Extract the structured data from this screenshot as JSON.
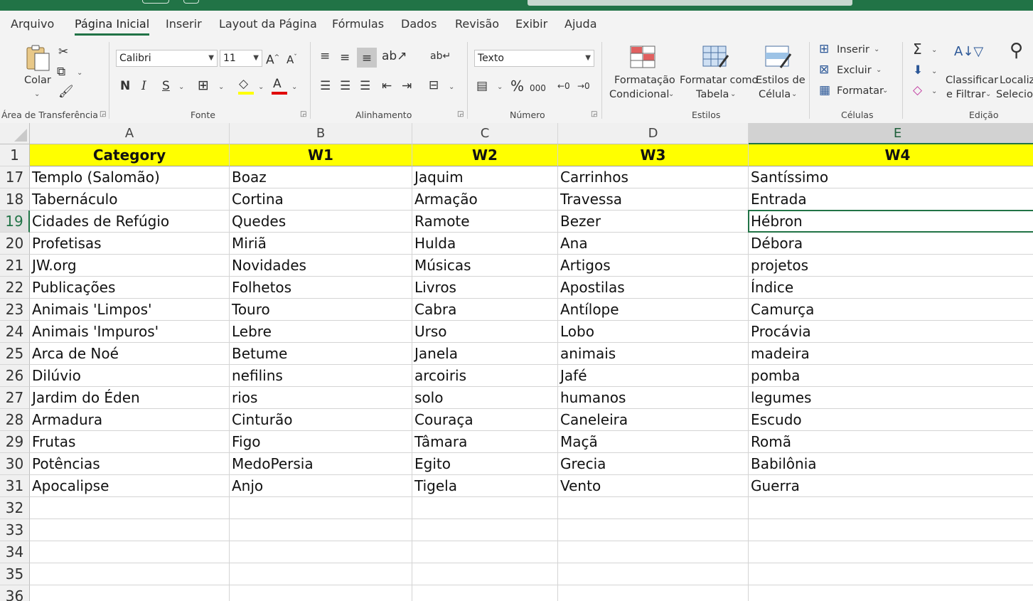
{
  "menu": {
    "tabs": [
      "Arquivo",
      "Página Inicial",
      "Inserir",
      "Layout da Página",
      "Fórmulas",
      "Dados",
      "Revisão",
      "Exibir",
      "Ajuda"
    ],
    "active": "Página Inicial"
  },
  "ribbon": {
    "clipboard": {
      "paste_label": "Colar",
      "group_label": "Área de Transferência"
    },
    "font": {
      "font_name": "Calibri",
      "font_size": "11",
      "bold": "N",
      "italic": "I",
      "underline": "S",
      "group_label": "Fonte"
    },
    "alignment": {
      "group_label": "Alinhamento"
    },
    "number": {
      "format": "Texto",
      "percent": "%",
      "thousands": "000",
      "group_label": "Número"
    },
    "styles": {
      "cond_format_line1": "Formatação",
      "cond_format_line2": "Condicional",
      "format_table_line1": "Formatar como",
      "format_table_line2": "Tabela",
      "cell_styles_line1": "Estilos de",
      "cell_styles_line2": "Célula",
      "group_label": "Estilos"
    },
    "cells": {
      "insert": "Inserir",
      "delete": "Excluir",
      "format": "Formatar",
      "group_label": "Células"
    },
    "editing": {
      "sort_line1": "Classificar",
      "sort_line2": "e Filtrar",
      "find_line1": "Localiz",
      "find_line2": "Selecion",
      "group_label": "Edição"
    }
  },
  "sheet": {
    "columns": [
      "A",
      "B",
      "C",
      "D",
      "E"
    ],
    "selected_column": "E",
    "selected_row": "19",
    "header_row_number": "1",
    "headers": [
      "Category",
      "W1",
      "W2",
      "W3",
      "W4"
    ],
    "header_color": "#ffff00",
    "rows": [
      {
        "num": "17",
        "cells": [
          "Templo (Salomão)",
          "Boaz",
          "Jaquim",
          "Carrinhos",
          "Santíssimo"
        ]
      },
      {
        "num": "18",
        "cells": [
          "Tabernáculo",
          "Cortina",
          "Armação",
          "Travessa",
          "Entrada"
        ]
      },
      {
        "num": "19",
        "cells": [
          "Cidades de Refúgio",
          "Quedes",
          "Ramote",
          "Bezer",
          "Hébron"
        ]
      },
      {
        "num": "20",
        "cells": [
          "Profetisas",
          "Miriã",
          "Hulda",
          "Ana",
          "Débora"
        ]
      },
      {
        "num": "21",
        "cells": [
          "JW.org",
          "Novidades",
          "Músicas",
          "Artigos",
          "projetos"
        ]
      },
      {
        "num": "22",
        "cells": [
          "Publicações",
          "Folhetos",
          "Livros",
          "Apostilas",
          "Índice"
        ]
      },
      {
        "num": "23",
        "cells": [
          "Animais 'Limpos'",
          "Touro",
          "Cabra",
          "Antílope",
          "Camurça"
        ]
      },
      {
        "num": "24",
        "cells": [
          "Animais 'Impuros'",
          "Lebre",
          "Urso",
          "Lobo",
          "Procávia"
        ]
      },
      {
        "num": "25",
        "cells": [
          "Arca de Noé",
          "Betume",
          "Janela",
          "animais",
          "madeira"
        ]
      },
      {
        "num": "26",
        "cells": [
          "Dilúvio",
          "nefilins",
          "arcoiris",
          "Jafé",
          "pomba"
        ]
      },
      {
        "num": "27",
        "cells": [
          "Jardim do Éden",
          "rios",
          "solo",
          "humanos",
          "legumes"
        ]
      },
      {
        "num": "28",
        "cells": [
          "Armadura",
          "Cinturão",
          "Couraça",
          "Caneleira",
          "Escudo"
        ]
      },
      {
        "num": "29",
        "cells": [
          "Frutas",
          "Figo",
          "Tâmara",
          "Maçã",
          "Romã"
        ]
      },
      {
        "num": "30",
        "cells": [
          "Potências",
          "MedoPersia",
          "Egito",
          "Grecia",
          "Babilônia"
        ]
      },
      {
        "num": "31",
        "cells": [
          "Apocalipse",
          "Anjo",
          "Tigela",
          "Vento",
          "Guerra"
        ]
      },
      {
        "num": "32",
        "cells": [
          "",
          "",
          "",
          "",
          ""
        ]
      },
      {
        "num": "33",
        "cells": [
          "",
          "",
          "",
          "",
          ""
        ]
      },
      {
        "num": "34",
        "cells": [
          "",
          "",
          "",
          "",
          ""
        ]
      },
      {
        "num": "35",
        "cells": [
          "",
          "",
          "",
          "",
          ""
        ]
      },
      {
        "num": "36",
        "cells": [
          "",
          "",
          "",
          "",
          ""
        ]
      }
    ]
  }
}
